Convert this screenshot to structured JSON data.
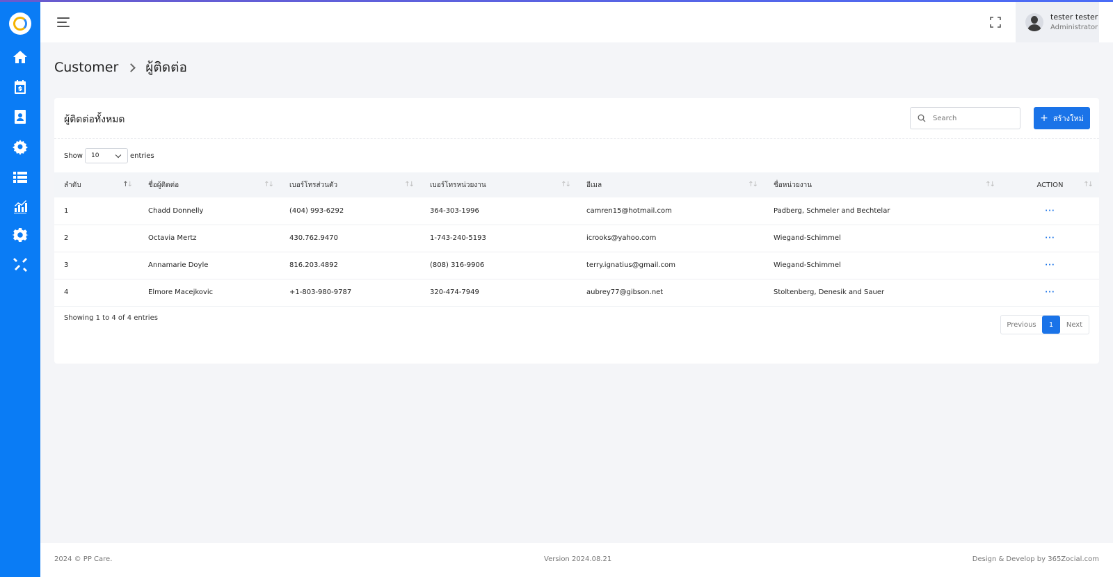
{
  "sidebar": {
    "logo": "logo",
    "items": [
      {
        "icon": "home-icon"
      },
      {
        "icon": "calendar-dollar-icon"
      },
      {
        "icon": "contact-book-icon"
      },
      {
        "icon": "gear-group-icon"
      },
      {
        "icon": "list-icon"
      },
      {
        "icon": "chart-icon"
      },
      {
        "icon": "settings-icon"
      },
      {
        "icon": "tools-icon"
      }
    ],
    "color": "#0a7cf5"
  },
  "header": {
    "user_name": "tester tester",
    "user_role": "Administrator"
  },
  "breadcrumb": {
    "parent": "Customer",
    "current": "ผู้ติดต่อ"
  },
  "card": {
    "title": "ผู้ติดต่อทั้งหมด",
    "search_placeholder": "Search",
    "create_label": "สร้างใหม่",
    "create_plus": "+",
    "show_label": "Show",
    "entries_label": "entries",
    "page_size": "10",
    "accent": "#1a73e8"
  },
  "table": {
    "columns": [
      "ลำดับ",
      "ชื่อผู้ติดต่อ",
      "เบอร์โทรส่วนตัว",
      "เบอร์โทรหน่วยงาน",
      "อีเมล",
      "ชื่อหน่วยงาน",
      "ACTION"
    ],
    "rows": [
      {
        "no": "1",
        "name": "Chadd Donnelly",
        "phone": "(404) 993-6292",
        "org_phone": "364-303-1996",
        "email": "camren15@hotmail.com",
        "org": "Padberg, Schmeler and Bechtelar",
        "action": "···"
      },
      {
        "no": "2",
        "name": "Octavia Mertz",
        "phone": "430.762.9470",
        "org_phone": "1-743-240-5193",
        "email": "icrooks@yahoo.com",
        "org": "Wiegand-Schimmel",
        "action": "···"
      },
      {
        "no": "3",
        "name": "Annamarie Doyle",
        "phone": "816.203.4892",
        "org_phone": "(808) 316-9906",
        "email": "terry.ignatius@gmail.com",
        "org": "Wiegand-Schimmel",
        "action": "···"
      },
      {
        "no": "4",
        "name": "Elmore Macejkovic",
        "phone": "+1-803-980-9787",
        "org_phone": "320-474-7949",
        "email": "aubrey77@gibson.net",
        "org": "Stoltenberg, Denesik and Sauer",
        "action": "···"
      }
    ]
  },
  "pagination": {
    "showing": "Showing 1 to 4 of 4 entries",
    "previous": "Previous",
    "page": "1",
    "next": "Next"
  },
  "footer": {
    "copyright": "2024 © PP Care.",
    "version": "Version 2024.08.21",
    "credit": "Design & Develop by 365Zocial.com"
  }
}
